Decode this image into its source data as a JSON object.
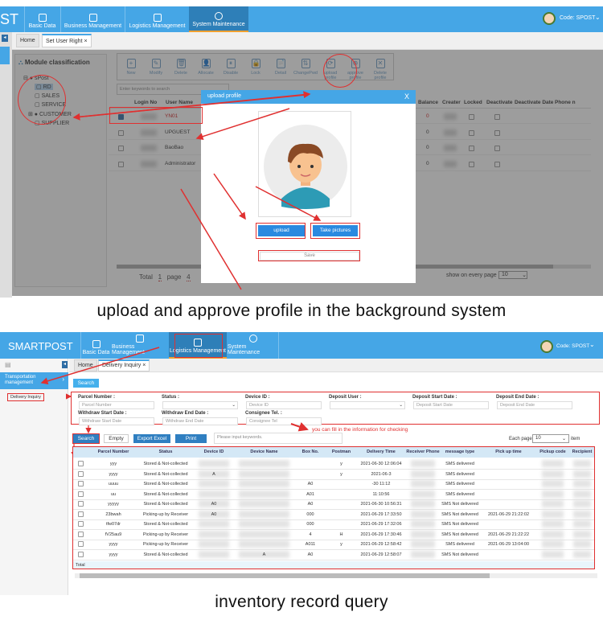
{
  "s1": {
    "logo": "ST",
    "nav": [
      "Basic Data",
      "Business Management",
      "Logistics Management",
      "System Maintenance"
    ],
    "code": "Code: SPOST",
    "tabs": [
      "Home",
      "Set User Right"
    ],
    "tab_close": "×",
    "tree_title": "Module classification",
    "tree": [
      "sPost",
      "RD",
      "SALES",
      "SERVICE",
      "CUSTOMER",
      "SUPPLIER"
    ],
    "toolbar": [
      "New",
      "Modify",
      "Delete",
      "Allocate",
      "Disable",
      "Lock",
      "Detail",
      "ChangePwd",
      "upload profile",
      "approve profile",
      "Delete profile"
    ],
    "toolbar_icons": [
      "+",
      "✎",
      "🗑",
      "👤",
      "⏸",
      "🔒",
      "📄",
      "⇅",
      "⟳",
      "⊕",
      "✕"
    ],
    "search_placeholder": "Enter keywords to search",
    "cols": [
      "Login No",
      "User Name",
      "Balance",
      "Creater",
      "Locked",
      "Deactivate",
      "Deactivate Date",
      "Phone n"
    ],
    "users": [
      "YN01",
      "UPGUEST",
      "BaoBao",
      "Administrator"
    ],
    "balances": [
      "0",
      "0",
      "0",
      "0"
    ],
    "pager": {
      "total_label": "Total",
      "total": "1",
      "page_label": "page",
      "pages": "4",
      "per_page_label": "show on every page",
      "per_page": "10"
    },
    "modal": {
      "title": "upload profile",
      "close": "X",
      "upload": "upload",
      "take": "Take pictures",
      "save": "Save"
    }
  },
  "caption1": "upload and approve profile in the background system",
  "s2": {
    "logo": "SMARTPOST",
    "nav": [
      "Basic Data",
      "Business Management",
      "Logistics Management",
      "System Maintenance"
    ],
    "code": "Code: SPOST",
    "side_group": "Transportation management",
    "side_item": "Delivery Inquiry",
    "tabs": [
      "Home",
      "Delivery Inquiry"
    ],
    "tab_close": "×",
    "top_search": "Search",
    "form": [
      {
        "label": "Parcel Number :",
        "ph": "Parcel Number"
      },
      {
        "label": "Status :",
        "ph": ""
      },
      {
        "label": "Device ID :",
        "ph": "Device ID"
      },
      {
        "label": "Deposit User :",
        "ph": ""
      },
      {
        "label": "Deposit Start Date :",
        "ph": "Deposit Start Date"
      },
      {
        "label": "Deposit End Date :",
        "ph": "Deposit End Date"
      },
      {
        "label": "Withdraw Start Date :",
        "ph": "Withdraw Start Date"
      },
      {
        "label": "Withdraw End Date :",
        "ph": "Withdraw End Date"
      },
      {
        "label": "Consignee Tel. :",
        "ph": "Consignee Tel"
      }
    ],
    "hint": "you can fill in the information for checking",
    "buttons": {
      "search": "Search",
      "empty": "Empty",
      "export": "Export Excel",
      "print": "Print"
    },
    "keyword_placeholder": "Please input keywords.",
    "each_page": "Each page",
    "each_value": "10",
    "item": "item",
    "columns": [
      "Parcel Number",
      "Status",
      "Device ID",
      "Device Name",
      "Box No.",
      "Postman",
      "Delivery Time",
      "Receiver Phone",
      "message type",
      "Pick up time",
      "Pickup code",
      "Recipient"
    ],
    "rows": [
      [
        "yyy",
        "Stored & Not-collected",
        "",
        "",
        "",
        "y",
        "2021-06-30 12:06:04",
        "",
        "SMS delivered",
        "",
        "",
        ""
      ],
      [
        "yyyy",
        "Stored & Not-collected",
        "A",
        "",
        "",
        "y",
        "2021-06-3",
        "",
        "SMS delivered",
        "",
        "",
        ""
      ],
      [
        "uuuu",
        "Stored & Not-collected",
        "",
        "",
        "A0",
        "",
        "-30 11:12",
        "",
        "SMS delivered",
        "",
        "",
        ""
      ],
      [
        "uu",
        "Stored & Not-collected",
        "",
        "",
        "A01",
        "",
        "11:10:56",
        "",
        "SMS delivered",
        "",
        "",
        ""
      ],
      [
        "yyyyy",
        "Stored & Not-collected",
        "A0",
        "",
        "A0",
        "",
        "2021-06-30 10:56:31",
        "",
        "SMS Not delivered",
        "",
        "",
        ""
      ],
      [
        "23bwah",
        "Picking-up by Receiver",
        "A0",
        "",
        "000",
        "",
        "2021-06-29 17:33:50",
        "",
        "SMS Not delivered",
        "2021-06-29 21:22:02",
        "",
        ""
      ],
      [
        "tfw07dr",
        "Stored & Not-collected",
        "",
        "",
        "000",
        "",
        "2021-06-29 17:32:06",
        "",
        "SMS Not delivered",
        "",
        "",
        ""
      ],
      [
        "fV25au9",
        "Picking-up by Receiver",
        "",
        "",
        "4",
        "H",
        "2021-06-29 17:30:46",
        "",
        "SMS Not delivered",
        "2021-06-29 21:22:22",
        "",
        ""
      ],
      [
        "yyyy",
        "Picking-up by Receiver",
        "",
        "",
        "A011",
        "y",
        "2021-06-29 12:58:42",
        "",
        "SMS delivered",
        "2021-06-29 13:04:00",
        "",
        ""
      ],
      [
        "yyyy",
        "Stored & Not-collected",
        "",
        "A",
        "A0",
        "",
        "2021-06-29 12:58:07",
        "",
        "SMS Not delivered",
        "",
        "",
        ""
      ]
    ],
    "total_label": "Total"
  },
  "caption2": "inventory record query"
}
